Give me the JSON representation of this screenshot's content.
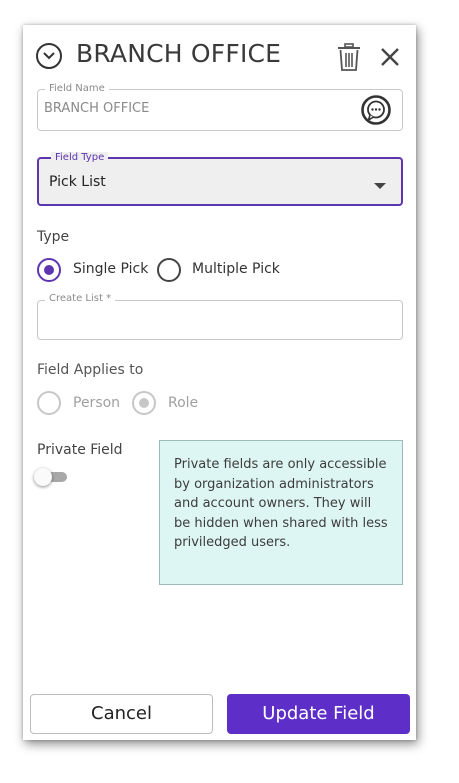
{
  "header": {
    "title": "BRANCH OFFICE",
    "collapse_icon": "chevron-down-circle-icon",
    "delete_icon": "trash-icon",
    "close_icon": "close-icon"
  },
  "field_name": {
    "legend": "Field Name",
    "value": "BRANCH OFFICE",
    "action_icon": "chat-bubble-icon"
  },
  "field_type": {
    "legend": "Field Type",
    "value": "Pick List"
  },
  "type_section": {
    "label": "Type",
    "options": [
      {
        "label": "Single Pick",
        "selected": true
      },
      {
        "label": "Multiple Pick",
        "selected": false
      }
    ]
  },
  "create_list": {
    "legend": "Create List *",
    "value": ""
  },
  "applies_to": {
    "label": "Field Applies to",
    "options": [
      {
        "label": "Person",
        "selected": false
      },
      {
        "label": "Role",
        "selected": true
      }
    ]
  },
  "private_field": {
    "label": "Private Field",
    "enabled": false,
    "tooltip": "Private fields are only accessible by organization administrators and account owners. They will be hidden when shared with less priviledged users."
  },
  "footer": {
    "cancel_label": "Cancel",
    "update_label": "Update Field"
  },
  "colors": {
    "accent": "#5e2ec9",
    "tooltip_bg": "#ddf5f3"
  }
}
